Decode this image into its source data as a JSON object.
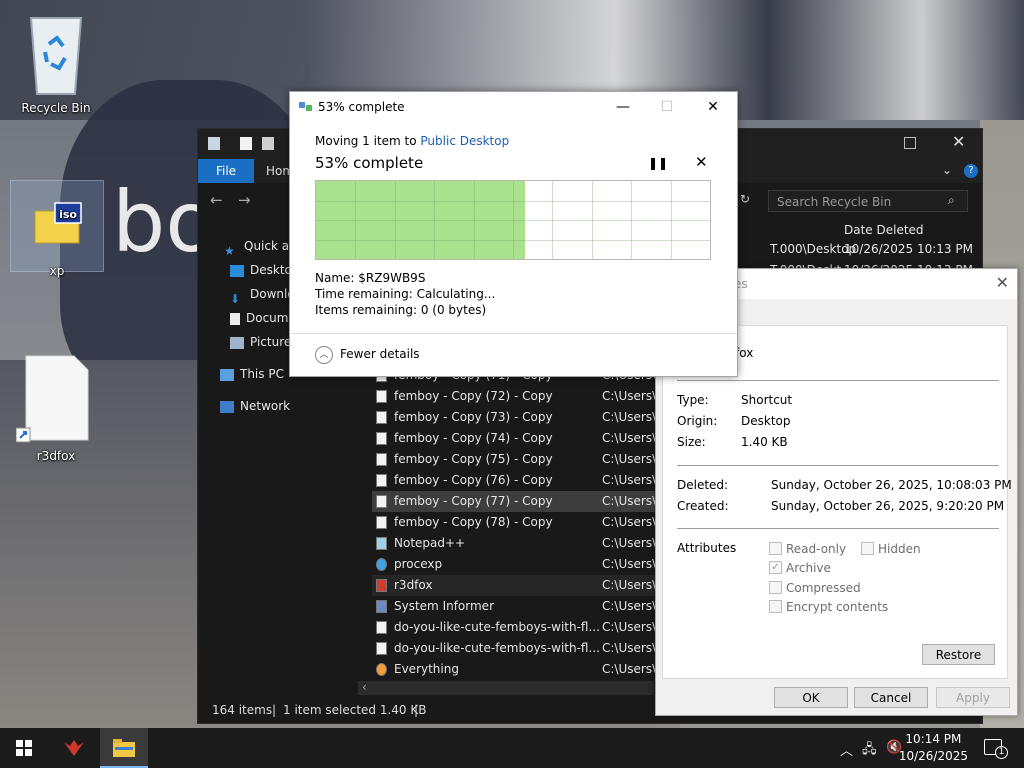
{
  "desktop": {
    "icons": [
      {
        "label": "Recycle Bin"
      },
      {
        "label": "xp"
      },
      {
        "label": "r3dfox"
      }
    ],
    "wallpaper_text": "bo"
  },
  "explorer": {
    "ribbon": {
      "file_tab": "File",
      "home_tab": "Hom"
    },
    "search_placeholder": "Search Recycle Bin",
    "nav": {
      "quick_access": "Quick ac",
      "desktop": "Desktop",
      "downloads": "Downlo",
      "documents": "Docum",
      "pictures": "Picture",
      "this_pc": "This PC",
      "network": "Network"
    },
    "column_date_header": "Date Deleted",
    "top_rows": [
      {
        "location": "T.000\\Desktop",
        "date": "10/26/2025 10:13 PM"
      },
      {
        "location": "T.000\\Deskt",
        "date": "10/26/2025 10:13 PM"
      }
    ],
    "files": [
      {
        "name": "femboy - Copy (71) - Copy",
        "location": "C:\\Users\\"
      },
      {
        "name": "femboy - Copy (72) - Copy",
        "location": "C:\\Users\\"
      },
      {
        "name": "femboy - Copy (73) - Copy",
        "location": "C:\\Users\\"
      },
      {
        "name": "femboy - Copy (74) - Copy",
        "location": "C:\\Users\\"
      },
      {
        "name": "femboy - Copy (75) - Copy",
        "location": "C:\\Users\\"
      },
      {
        "name": "femboy - Copy (76) - Copy",
        "location": "C:\\Users\\"
      },
      {
        "name": "femboy - Copy (77) - Copy",
        "location": "C:\\Users\\"
      },
      {
        "name": "femboy - Copy (78) - Copy",
        "location": "C:\\Users\\"
      },
      {
        "name": "Notepad++",
        "location": "C:\\Users\\"
      },
      {
        "name": "procexp",
        "location": "C:\\Users\\"
      },
      {
        "name": "r3dfox",
        "location": "C:\\Users\\"
      },
      {
        "name": "System Informer",
        "location": "C:\\Users\\"
      },
      {
        "name": "do-you-like-cute-femboys-with-fl...",
        "location": "C:\\Users\\"
      },
      {
        "name": "do-you-like-cute-femboys-with-fl...",
        "location": "C:\\Users\\"
      },
      {
        "name": "Everything",
        "location": "C:\\Users\\"
      }
    ],
    "status": {
      "items": "164 items",
      "selected": "1 item selected  1.40 KB"
    }
  },
  "properties": {
    "title_fragment": "ties",
    "name_fragment": "fox",
    "type_label": "Type:",
    "type_value": "Shortcut",
    "origin_label": "Origin:",
    "origin_value": "Desktop",
    "size_label": "Size:",
    "size_value": "1.40 KB",
    "deleted_label": "Deleted:",
    "deleted_value": "Sunday, October 26, 2025, 10:08:03 PM",
    "created_label": "Created:",
    "created_value": "Sunday, October 26, 2025, 9:20:20 PM",
    "attributes_label": "Attributes",
    "readonly": "Read-only",
    "hidden": "Hidden",
    "archive": "Archive",
    "compressed": "Compressed",
    "encrypt": "Encrypt contents",
    "restore": "Restore",
    "ok": "OK",
    "cancel": "Cancel",
    "apply": "Apply"
  },
  "progress": {
    "title": "53% complete",
    "moving_prefix": "Moving 1 item to ",
    "destination": "Public Desktop",
    "headline": "53% complete",
    "percent": 53,
    "name_line": "Name:  $RZ9WB9S",
    "time_line": "Time remaining:  Calculating...",
    "items_line": "Items remaining:  0 (0 bytes)",
    "fewer_details": "Fewer details"
  },
  "taskbar": {
    "time": "10:14 PM",
    "date": "10/26/2025",
    "notification_count": "1"
  },
  "colors": {
    "progress_fill": "#a8e28e",
    "accent": "#1a6fc2",
    "link": "#1a5fb4"
  }
}
